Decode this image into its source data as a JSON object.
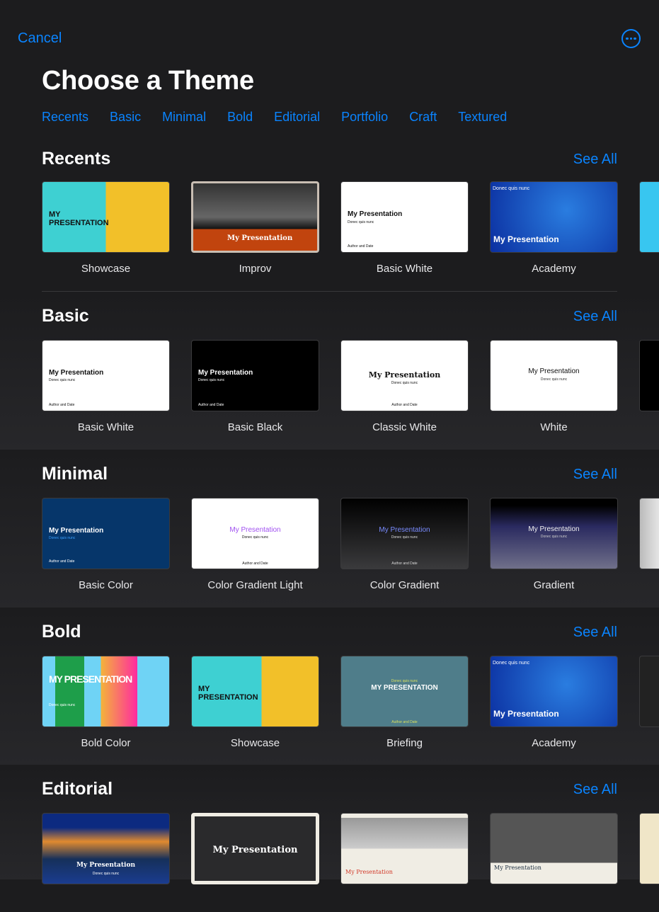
{
  "header": {
    "cancel": "Cancel",
    "title": "Choose a Theme",
    "more_icon": "ellipsis-circle-icon"
  },
  "categories": [
    "Recents",
    "Basic",
    "Minimal",
    "Bold",
    "Editorial",
    "Portfolio",
    "Craft",
    "Textured"
  ],
  "see_all": "See All",
  "thumb_text": {
    "my_presentation": "My Presentation",
    "my_presentation_caps": "MY PRESENTATION",
    "subtitle": "Donec quis nunc",
    "author": "Author and Date"
  },
  "sections": [
    {
      "title": "Recents",
      "items": [
        "Showcase",
        "Improv",
        "Basic White",
        "Academy"
      ]
    },
    {
      "title": "Basic",
      "items": [
        "Basic White",
        "Basic Black",
        "Classic White",
        "White"
      ]
    },
    {
      "title": "Minimal",
      "items": [
        "Basic Color",
        "Color Gradient Light",
        "Color Gradient",
        "Gradient"
      ]
    },
    {
      "title": "Bold",
      "items": [
        "Bold Color",
        "Showcase",
        "Briefing",
        "Academy"
      ]
    },
    {
      "title": "Editorial",
      "items": [
        "",
        "",
        "",
        "",
        ""
      ]
    }
  ],
  "colors": {
    "accent": "#0a84ff",
    "background": "#1c1c1e"
  }
}
